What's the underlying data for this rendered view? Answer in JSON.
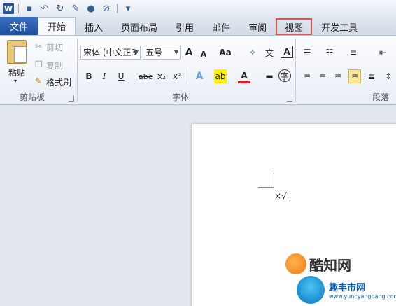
{
  "quick_access": {
    "items": [
      {
        "name": "save-icon",
        "glyph": "💾"
      },
      {
        "name": "undo-icon",
        "glyph": "↶"
      },
      {
        "name": "redo-icon",
        "glyph": "↻"
      }
    ]
  },
  "tabs": [
    {
      "label": "文件"
    },
    {
      "label": "开始"
    },
    {
      "label": "插入"
    },
    {
      "label": "页面布局"
    },
    {
      "label": "引用"
    },
    {
      "label": "邮件"
    },
    {
      "label": "审阅"
    },
    {
      "label": "视图"
    },
    {
      "label": "开发工具"
    }
  ],
  "clipboard": {
    "paste": "粘贴",
    "cut": "剪切",
    "copy": "复制",
    "format_painter": "格式刷",
    "group_label": "剪贴板"
  },
  "font": {
    "family": "宋体 (中文正3",
    "size": "五号",
    "grow": "A",
    "shrink": "A",
    "change_case": "Aa",
    "bold": "B",
    "italic": "I",
    "underline": "U",
    "strike": "abc",
    "subscript": "x₂",
    "superscript": "x²",
    "group_label": "字体"
  },
  "paragraph": {
    "group_label": "段落"
  },
  "document": {
    "text": "×√"
  },
  "watermark": {
    "brand1": "酷知网",
    "brand2": "趣丰市网",
    "url": "www.yuncyangbang.com"
  }
}
